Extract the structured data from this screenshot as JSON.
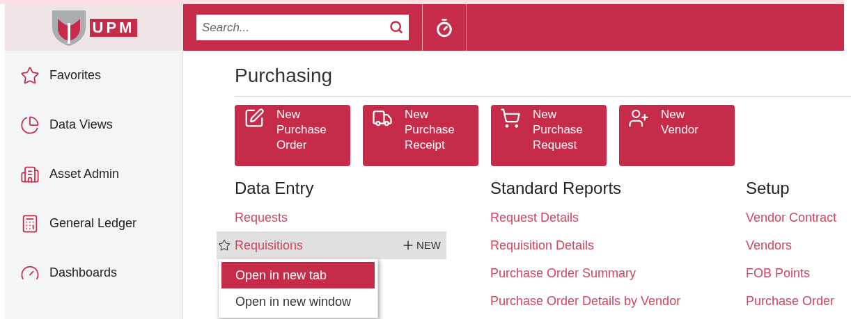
{
  "header": {
    "logo_text": "UPM",
    "search": {
      "placeholder": "Search..."
    }
  },
  "sidebar": {
    "items": [
      {
        "label": "Favorites",
        "selected": false
      },
      {
        "label": "Data Views",
        "selected": false
      },
      {
        "label": "Asset Admin",
        "selected": false
      },
      {
        "label": "General Ledger",
        "selected": false
      },
      {
        "label": "Dashboards",
        "selected": false
      }
    ]
  },
  "page": {
    "title": "Purchasing",
    "tiles": [
      {
        "lines": [
          "New",
          "Purchase",
          "Order"
        ]
      },
      {
        "lines": [
          "New",
          "Purchase",
          "Receipt"
        ]
      },
      {
        "lines": [
          "New",
          "Purchase",
          "Request"
        ]
      },
      {
        "lines": [
          "New",
          "Vendor"
        ]
      }
    ],
    "sections": [
      {
        "heading": "Data Entry",
        "links": [
          {
            "label": "Requests",
            "hovered": false
          },
          {
            "label": "Requisitions",
            "hovered": true,
            "new_label": "NEW"
          }
        ]
      },
      {
        "heading": "Standard Reports",
        "links": [
          {
            "label": "Request Details",
            "hovered": false
          },
          {
            "label": "Requisition Details",
            "hovered": false
          },
          {
            "label": "Purchase Order Summary",
            "hovered": false
          },
          {
            "label": "Purchase Order Details by Vendor",
            "hovered": false
          }
        ]
      },
      {
        "heading": "Setup",
        "links": [
          {
            "label": "Vendor Contract",
            "hovered": false
          },
          {
            "label": "Vendors",
            "hovered": false
          },
          {
            "label": "FOB Points",
            "hovered": false
          },
          {
            "label": "Purchase Order",
            "hovered": false
          }
        ]
      }
    ]
  },
  "context_menu": {
    "items": [
      {
        "label": "Open in new tab",
        "selected": true
      },
      {
        "label": "Open in new window",
        "selected": false
      }
    ]
  }
}
